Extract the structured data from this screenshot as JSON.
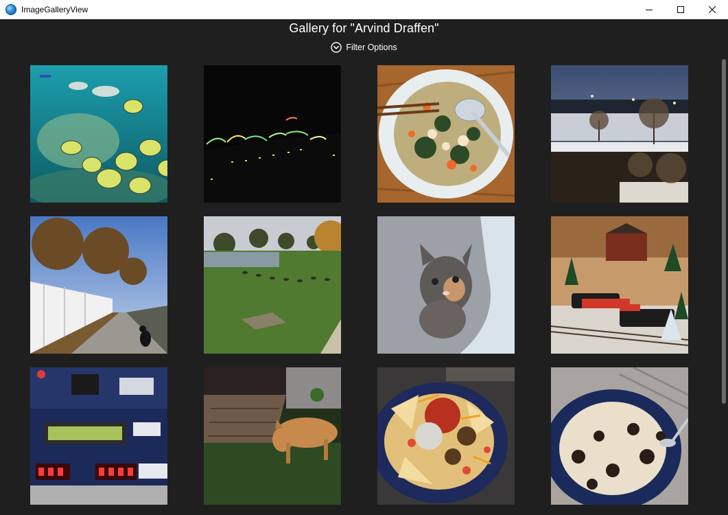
{
  "window": {
    "title": "ImageGalleryView",
    "app_icon": "app-globe-icon"
  },
  "header": {
    "gallery_title": "Gallery for \"Arvind Draffen\"",
    "filter_label": "Filter Options",
    "filter_icon": "chevron-down-circle-icon"
  },
  "gallery": {
    "images": [
      {
        "subject": "aquarium-fish"
      },
      {
        "subject": "night-lights"
      },
      {
        "subject": "soup-bowl"
      },
      {
        "subject": "snowy-lot-dusk"
      },
      {
        "subject": "fence-dog-sidewalk"
      },
      {
        "subject": "pond-geese-park"
      },
      {
        "subject": "kitten-window"
      },
      {
        "subject": "model-train-christmas"
      },
      {
        "subject": "fpga-board"
      },
      {
        "subject": "dog-on-grass"
      },
      {
        "subject": "nachos-plate"
      },
      {
        "subject": "cookies-ice-cream"
      }
    ]
  },
  "colors": {
    "background": "#1f1f1f",
    "titlebar": "#ffffff",
    "text": "#ffffff"
  }
}
